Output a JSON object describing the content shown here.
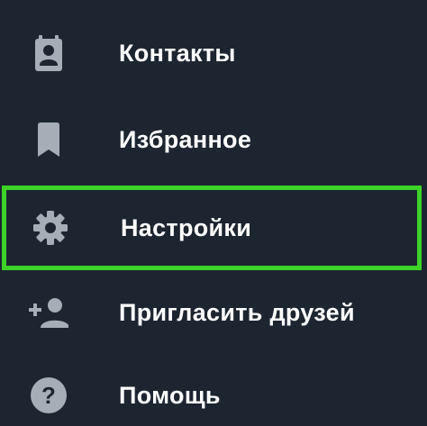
{
  "menu": {
    "items": [
      {
        "label": "Контакты",
        "icon": "contacts-icon"
      },
      {
        "label": "Избранное",
        "icon": "bookmark-icon"
      },
      {
        "label": "Настройки",
        "icon": "settings-gear-icon",
        "highlighted": true
      },
      {
        "label": "Пригласить друзей",
        "icon": "add-person-icon"
      },
      {
        "label": "Помощь",
        "icon": "help-icon"
      }
    ],
    "colors": {
      "background": "#1c2530",
      "icon": "#a6adb7",
      "text": "#ffffff",
      "highlight_border": "#3dd327"
    }
  }
}
